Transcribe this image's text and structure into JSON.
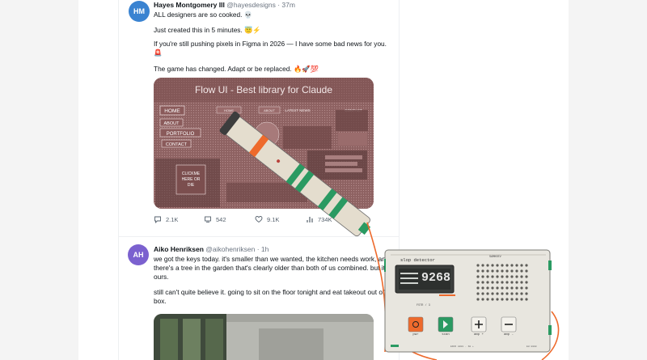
{
  "posts": [
    {
      "avatar_initials": "HM",
      "author": "Hayes Montgomery III",
      "handle": "@hayesdesigns",
      "time": "· 37m",
      "paragraphs": [
        "ALL designers are so cooked. 💀",
        "Just created this in 5 minutes. 😇⚡",
        "If you're still pushing pixels in Figma in 2026 — I have some bad news for you. 🚨",
        "The game has changed. Adapt or be replaced. 🔥🚀💯"
      ],
      "media": {
        "title": "Flow UI - Best library for Claude",
        "nav_items": [
          "HOME",
          "ABOUT",
          "PORTFOLIO",
          "CONTACT"
        ],
        "top_links": [
          "HOME",
          "ABOUT",
          "LATEST NEWS",
          "CONTACT"
        ],
        "promo": "CLICKME\nHERE OR\nDIE"
      },
      "stats": {
        "replies": "2.1K",
        "reposts": "542",
        "likes": "9.1K",
        "views": "734K"
      }
    },
    {
      "avatar_initials": "AH",
      "author": "Aiko Henriksen",
      "handle": "@aikohenriksen",
      "time": "· 1h",
      "paragraphs": [
        "we got the keys today. it's smaller than we wanted, the kitchen needs work, and there's a tree in the garden that's clearly older than both of us combined. but it's ours.",
        "still can't quite believe it. going to sit on the floor tonight and eat takeout out of the box."
      ]
    }
  ],
  "device": {
    "label": "slop detector",
    "brand": "SAMHOEV",
    "reading": "9268",
    "scale_label": "FSTR / 3",
    "buttons": [
      "pwr",
      "scan",
      "amp +",
      "amp -"
    ],
    "footer": "ENCO A001 · 60 +",
    "footer_right": "EH 8008"
  },
  "colors": {
    "accent_orange": "#ee6a2c",
    "device_green": "#2a9a62",
    "device_body": "#e8e6df",
    "avatar_blue": "#3a83d1",
    "avatar_purple": "#7b61cf"
  }
}
